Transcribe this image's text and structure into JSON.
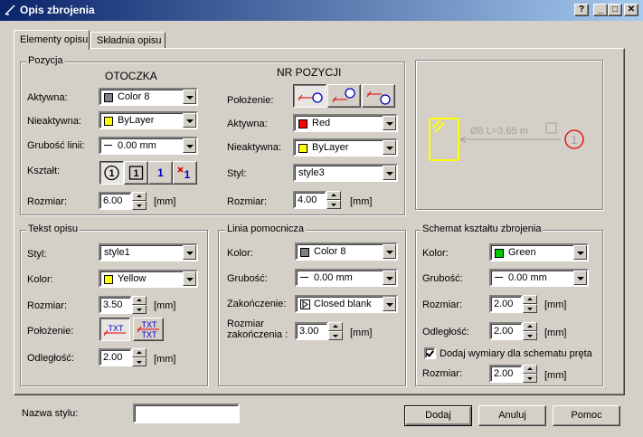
{
  "window": {
    "title": "Opis zbrojenia",
    "help_btn": "?",
    "min_btn": "_",
    "max_btn": "□",
    "close_btn": "✕"
  },
  "tabs": [
    {
      "label": "Elementy opisu"
    },
    {
      "label": "Składnia opisu"
    }
  ],
  "colors": {
    "red": "#ff0000",
    "yellow": "#ffff00",
    "green": "#00cc00",
    "gray": "#808080"
  },
  "pozycja": {
    "title": "Pozycja",
    "otoczka_heading": "OTOCZKA",
    "nr_heading": "NR POZYCJI",
    "aktywna_label": "Aktywna:",
    "aktywna_value": "Color 8",
    "nieaktywna_label": "Nieaktywna:",
    "nieaktywna_value": "ByLayer",
    "grubosc_label": "Grubość linii:",
    "grubosc_value": "0.00 mm",
    "ksztalt_label": "Kształt:",
    "ksztalt_opts": [
      "1",
      "1",
      "1",
      "1"
    ],
    "rozmiar_label": "Rozmiar:",
    "rozmiar_value": "6.00",
    "unit": "[mm]",
    "polozenie_label": "Położenie:",
    "nr_aktywna_label": "Aktywna:",
    "nr_aktywna_value": "Red",
    "nr_nieaktywna_label": "Nieaktywna:",
    "nr_nieaktywna_value": "ByLayer",
    "styl_label": "Styl:",
    "styl_value": "style3",
    "nr_rozmiar_label": "Rozmiar:",
    "nr_rozmiar_value": "4.00"
  },
  "preview": {
    "label_text": "Ø8  L=3.65 m",
    "number": "1"
  },
  "tekst": {
    "title": "Tekst opisu",
    "styl_label": "Styl:",
    "styl_value": "style1",
    "kolor_label": "Kolor:",
    "kolor_value": "Yellow",
    "rozmiar_label": "Rozmiar:",
    "rozmiar_value": "3.50",
    "unit": "[mm]",
    "polozenie_label": "Położenie:",
    "pos1": "TXT",
    "pos2a": "TXT",
    "pos2b": "TXT",
    "odleglosc_label": "Odległość:",
    "odleglosc_value": "2.00"
  },
  "linia": {
    "title": "Linia pomocnicza",
    "kolor_label": "Kolor:",
    "kolor_value": "Color 8",
    "grubosc_label": "Grubość:",
    "grubosc_value": "0.00 mm",
    "zakonczenie_label": "Zakończenie:",
    "zakonczenie_value": "Closed blank",
    "rozmiar_label1": "Rozmiar",
    "rozmiar_label2": "zakończenia :",
    "rozmiar_value": "3.00",
    "unit": "[mm]"
  },
  "schemat": {
    "title": "Schemat kształtu zbrojenia",
    "kolor_label": "Kolor:",
    "kolor_value": "Green",
    "grubosc_label": "Grubość:",
    "grubosc_value": "0.00 mm",
    "rozmiar_label": "Rozmiar:",
    "rozmiar_value": "2.00",
    "odleglosc_label": "Odległość:",
    "odleglosc_value": "2.00",
    "checkbox_label": "Dodaj wymiary dla schematu pręta",
    "rozmiar2_label": "Rozmiar:",
    "rozmiar2_value": "2.00",
    "unit": "[mm]"
  },
  "footer": {
    "nazwa_label": "Nazwa stylu:",
    "nazwa_value": "",
    "dodaj": "Dodaj",
    "anuluj": "Anuluj",
    "pomoc": "Pomoc"
  }
}
